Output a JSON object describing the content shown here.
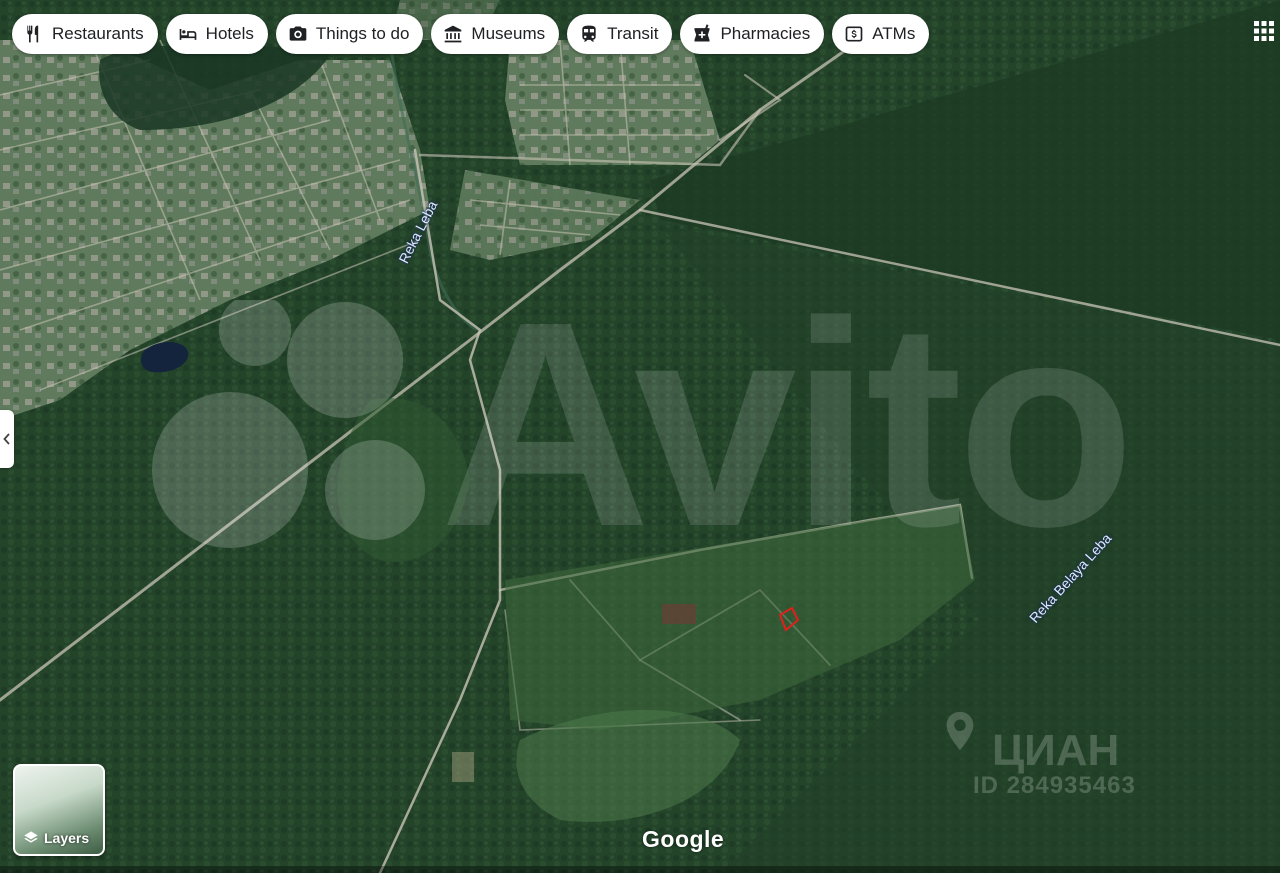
{
  "toolbar": {
    "chips": [
      {
        "label": "Restaurants",
        "icon": "fork-knife-icon"
      },
      {
        "label": "Hotels",
        "icon": "bed-icon"
      },
      {
        "label": "Things to do",
        "icon": "camera-icon"
      },
      {
        "label": "Museums",
        "icon": "museum-icon"
      },
      {
        "label": "Transit",
        "icon": "train-icon"
      },
      {
        "label": "Pharmacies",
        "icon": "pharmacy-icon"
      },
      {
        "label": "ATMs",
        "icon": "atm-icon"
      }
    ],
    "apps_icon": "grid-icon"
  },
  "map": {
    "labels": {
      "river_leba": "Reka Leba",
      "river_belaya_leba": "Reka Belaya Leba"
    },
    "layers_label": "Layers",
    "attribution": "Google",
    "colors": {
      "forest_dark": "#1f3d25",
      "forest": "#2a4d30",
      "field": "#4c7a4a",
      "road": "#c9c4b6",
      "parcel_marker": "#e0201c"
    }
  },
  "watermarks": {
    "avito": "Avito",
    "cian_name": "ЦИАН",
    "cian_id": "ID 284935463"
  }
}
